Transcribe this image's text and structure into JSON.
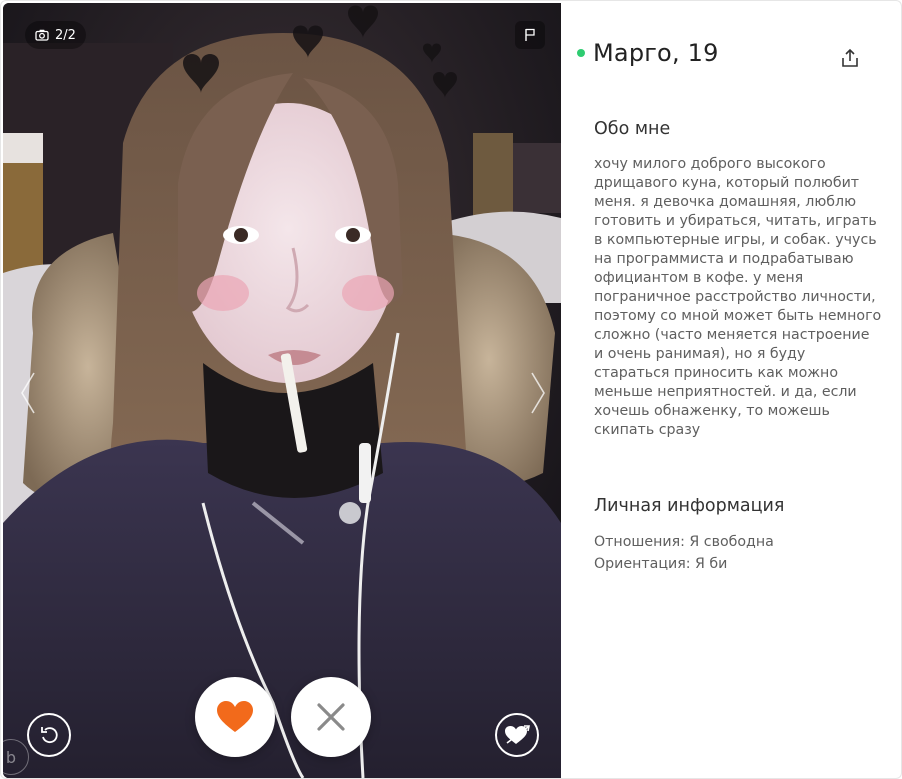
{
  "photo": {
    "counter": "2/2",
    "icons": {
      "camera": "camera-icon",
      "flag": "flag-icon",
      "prev": "chevron-left-icon",
      "next": "chevron-right-icon",
      "undo": "undo-icon",
      "like": "heart-icon",
      "dislike": "close-icon",
      "super_like": "heart-arrow-icon"
    },
    "watermark": "b"
  },
  "profile": {
    "name_age": "Марго, 19",
    "online_color": "#2ecc71",
    "share_icon": "share-icon"
  },
  "about": {
    "title": "Обо мне",
    "text": "хочу милого доброго высокого дрищавого куна, который полюбит меня. я девочка домашняя, люблю готовить и убираться, читать, играть в компьютерные игры, и собак. учусь на программиста и подрабатываю официантом в кофе. у меня пограничное расстройство личности, поэтому со мной может быть немного сложно (часто меняется настроение и очень ранимая), но я буду стараться приносить как можно меньше неприятностей. и да, если хочешь обнаженку, то можешь скипать сразу"
  },
  "personal": {
    "title": "Личная информация",
    "relationship": "Отношения: Я свободна",
    "orientation": "Ориентация: Я би"
  },
  "colors": {
    "like": "#f26a1b",
    "dislike": "#8a8a8a"
  }
}
